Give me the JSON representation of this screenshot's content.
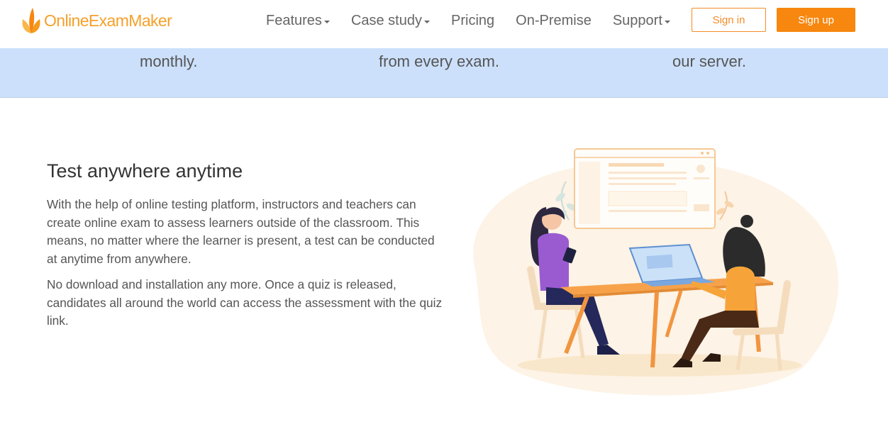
{
  "header": {
    "logo_text": "OnlineExamMaker",
    "nav": [
      {
        "label": "Features",
        "dropdown": true
      },
      {
        "label": "Case study",
        "dropdown": true
      },
      {
        "label": "Pricing",
        "dropdown": false
      },
      {
        "label": "On-Premise",
        "dropdown": false
      },
      {
        "label": "Support",
        "dropdown": true
      }
    ],
    "signin_label": "Sign in",
    "signup_label": "Sign up"
  },
  "band": {
    "items": [
      "monthly.",
      "from every exam.",
      "our server."
    ]
  },
  "section": {
    "heading": "Test anywhere anytime",
    "paragraph1": "With the help of online testing platform, instructors and teachers can create online exam to assess learners outside of the classroom. This means, no matter where the learner is present, a test can be conducted at anytime from anywhere.",
    "paragraph2": "No download and installation any more. Once a quiz is released, candidates all around the world can access the assessment with the quiz link."
  },
  "colors": {
    "brand_orange": "#f7870f",
    "band_blue": "#cce0fb"
  }
}
